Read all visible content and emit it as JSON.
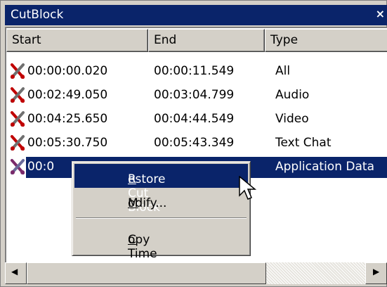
{
  "window": {
    "title": "CutBlock",
    "close_glyph": "×"
  },
  "columns": [
    {
      "label": "Start"
    },
    {
      "label": "End"
    },
    {
      "label": "Type"
    }
  ],
  "rows": [
    {
      "start": "00:00:00.020",
      "end": "00:00:11.549",
      "type": "All",
      "icon": "cut-scissors-icon"
    },
    {
      "start": "00:02:49.050",
      "end": "00:03:04.799",
      "type": "Audio",
      "icon": "cut-scissors-icon"
    },
    {
      "start": "00:04:25.650",
      "end": "00:04:44.549",
      "type": "Video",
      "icon": "cut-scissors-icon"
    },
    {
      "start": "00:05:30.750",
      "end": "00:05:43.349",
      "type": "Text Chat",
      "icon": "cut-scissors-icon"
    },
    {
      "start": "00:0",
      "end": "",
      "type": "Application Data",
      "icon": "cut-scissors-icon",
      "selected": true
    }
  ],
  "context_menu": {
    "items": [
      {
        "accel": "R",
        "rest": "estore Cut Block",
        "highlighted": true
      },
      {
        "accel": "M",
        "rest": "odify..."
      },
      {
        "accel": "C",
        "rest": "opy Time"
      }
    ]
  },
  "scrollbar": {
    "left_arrow": "◀",
    "right_arrow": "▶"
  },
  "colors": {
    "selection": "#0a246a",
    "face": "#d4d0c8",
    "icon_red": "#c00000",
    "icon_gray": "#707070"
  }
}
